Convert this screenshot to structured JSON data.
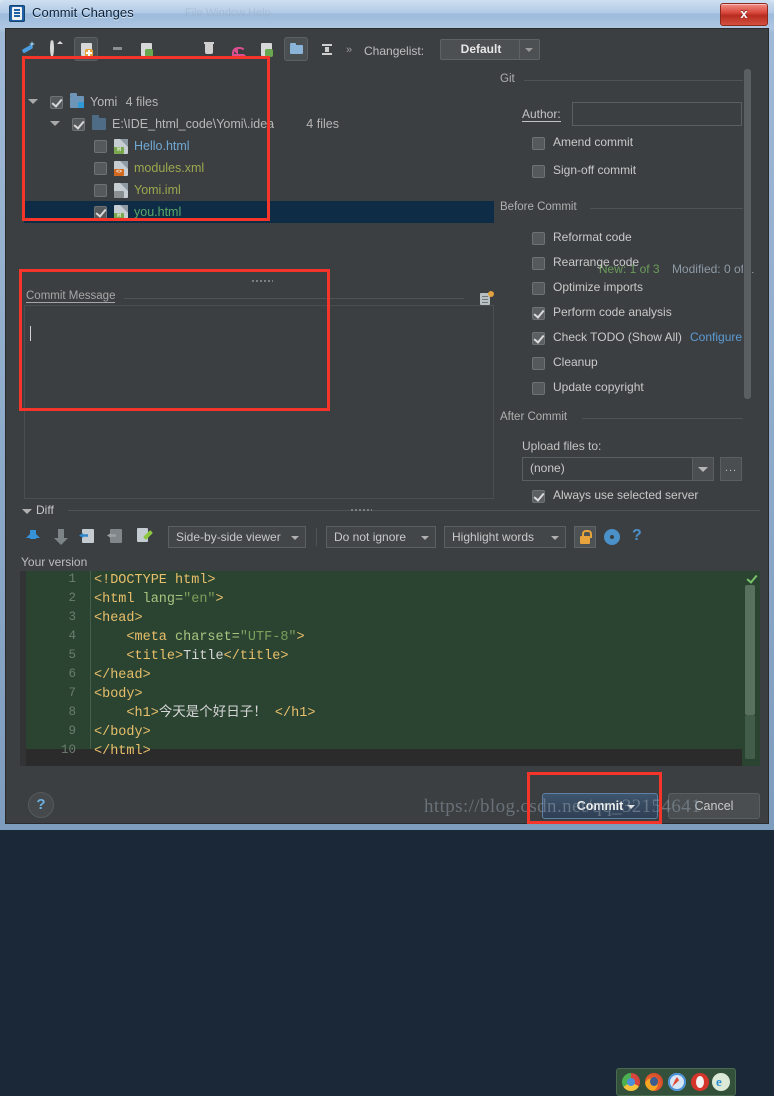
{
  "window": {
    "title": "Commit Changes",
    "close_label": "x",
    "ghost_menu": "File  Window  Help"
  },
  "toolbar": {
    "icons": [
      {
        "name": "show-diff-icon",
        "label": "Show Diff"
      },
      {
        "name": "refresh-icon",
        "label": "Refresh"
      },
      {
        "name": "add-to-vcs-icon",
        "label": "Add to VCS"
      },
      {
        "name": "move-icon",
        "label": "Move to Another Changelist"
      },
      {
        "name": "new-changelist-icon",
        "label": "New Changelist"
      },
      {
        "name": "delete-icon",
        "label": "Delete"
      },
      {
        "name": "remove-changelist-icon",
        "label": "Remove Changelist"
      },
      {
        "name": "rollback-icon",
        "label": "Rollback"
      },
      {
        "name": "show-ignored-icon",
        "label": "Show Ignored Files"
      },
      {
        "name": "group-by-directory-icon",
        "label": "Group By Directory"
      },
      {
        "name": "expand-collapse-icon",
        "label": "Collapse All"
      }
    ],
    "chevron": "»",
    "changelist_label": "Changelist:",
    "changelist_value": "Default"
  },
  "tree": {
    "rows": [
      {
        "label": "Yomi",
        "count": "4 files",
        "checked": true,
        "expanded": true,
        "kind": "root-folder",
        "depth": 0,
        "color": "#b8b8b8",
        "selected": false
      },
      {
        "label": "E:\\IDE_html_code\\Yomi\\.idea",
        "count": "4 files",
        "checked": true,
        "expanded": true,
        "kind": "folder",
        "depth": 1,
        "color": "#b8b8b8",
        "selected": false
      },
      {
        "label": "Hello.html",
        "count": "",
        "checked": false,
        "expanded": null,
        "kind": "html",
        "depth": 2,
        "color": "#6fa8d4",
        "selected": false
      },
      {
        "label": "modules.xml",
        "count": "",
        "checked": false,
        "expanded": null,
        "kind": "xml",
        "depth": 2,
        "color": "#9aa84f",
        "selected": false
      },
      {
        "label": "Yomi.iml",
        "count": "",
        "checked": false,
        "expanded": null,
        "kind": "iml",
        "depth": 2,
        "color": "#9aa84f",
        "selected": false
      },
      {
        "label": "you.html",
        "count": "",
        "checked": true,
        "expanded": null,
        "kind": "html",
        "depth": 2,
        "color": "#59a869",
        "selected": true
      }
    ],
    "status_new": "New: 1 of 3",
    "status_modified": "Modified: 0 of 1"
  },
  "commit_message": {
    "legend": "Commit Message",
    "value": "",
    "history_icon": "message-history-icon"
  },
  "right_panel": {
    "git": {
      "title": "Git",
      "author_label": "Author:",
      "author_value": "",
      "checkboxes": [
        {
          "label": "Amend commit",
          "checked": false,
          "name": "amend-commit"
        },
        {
          "label": "Sign-off commit",
          "checked": false,
          "name": "sign-off-commit"
        }
      ]
    },
    "before_commit": {
      "title": "Before Commit",
      "checkboxes": [
        {
          "label": "Reformat code",
          "checked": false,
          "name": "reformat-code"
        },
        {
          "label": "Rearrange code",
          "checked": false,
          "name": "rearrange-code"
        },
        {
          "label": "Optimize imports",
          "checked": false,
          "name": "optimize-imports"
        },
        {
          "label": "Perform code analysis",
          "checked": true,
          "name": "perform-code-analysis"
        },
        {
          "label": "Check TODO (Show All)",
          "checked": true,
          "name": "check-todo"
        },
        {
          "label": "Cleanup",
          "checked": false,
          "name": "cleanup"
        },
        {
          "label": "Update copyright",
          "checked": false,
          "name": "update-copyright"
        }
      ],
      "configure_link": "Configure"
    },
    "after_commit": {
      "title": "After Commit",
      "upload_label": "Upload files to:",
      "upload_value": "(none)",
      "ellipsis_label": "...",
      "always_use_label": "Always use selected server",
      "always_use_checked": true
    }
  },
  "diff": {
    "section_label": "Diff",
    "toolbar": {
      "prev_change": "previous-change-icon",
      "next_change": "next-change-icon",
      "accept_left": "accept-left-icon",
      "accept_right": "accept-right-icon",
      "edit_source": "edit-source-icon",
      "viewer_mode": "Side-by-side viewer",
      "ignore_mode": "Do not ignore",
      "highlight_mode": "Highlight words",
      "lock_icon": "lock-icon",
      "settings_icon": "gear-icon",
      "help_icon": "?"
    },
    "version_label": "Your version",
    "line_numbers": [
      "1",
      "2",
      "3",
      "4",
      "5",
      "6",
      "7",
      "8",
      "9",
      "10"
    ],
    "code_lines": [
      [
        {
          "t": "<!DOCTYPE html>",
          "c": "tg"
        }
      ],
      [
        {
          "t": "<html ",
          "c": "tg"
        },
        {
          "t": "lang=",
          "c": "at"
        },
        {
          "t": "\"en\"",
          "c": "st"
        },
        {
          "t": ">",
          "c": "tg"
        }
      ],
      [
        {
          "t": "<head>",
          "c": "tg"
        }
      ],
      [
        {
          "t": "    <meta ",
          "c": "tg"
        },
        {
          "t": "charset=",
          "c": "at"
        },
        {
          "t": "\"UTF-8\"",
          "c": "st"
        },
        {
          "t": ">",
          "c": "tg"
        }
      ],
      [
        {
          "t": "    <title>",
          "c": "tg"
        },
        {
          "t": "Title",
          "c": "tx"
        },
        {
          "t": "</title>",
          "c": "tg"
        }
      ],
      [
        {
          "t": "</head>",
          "c": "tg"
        }
      ],
      [
        {
          "t": "<body>",
          "c": "tg"
        }
      ],
      [
        {
          "t": "    <h1>",
          "c": "tg"
        },
        {
          "t": "今天是个好日子！ ",
          "c": "tx"
        },
        {
          "t": "</h1>",
          "c": "tg"
        }
      ],
      [
        {
          "t": "</body>",
          "c": "tg"
        }
      ],
      [
        {
          "t": "</html>",
          "c": "tg"
        }
      ]
    ],
    "browsers": [
      "chrome-icon",
      "firefox-icon",
      "safari-icon",
      "opera-icon",
      "ie-icon"
    ]
  },
  "footer": {
    "help_label": "?",
    "commit_label": "Commit",
    "cancel_label": "Cancel"
  },
  "watermark": "https://blog.csdn.net/qq_32154641",
  "colors": {
    "accent_blue": "#5b9bd5",
    "selection": "#0e2c46",
    "added_code_bg": "#2b4432",
    "annotation_red": "#f5342a",
    "dialog_bg": "#3c3f41"
  }
}
